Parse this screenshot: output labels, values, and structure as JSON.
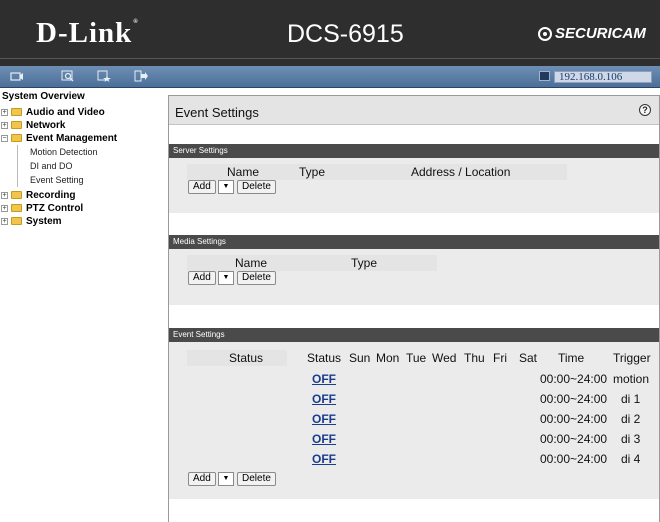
{
  "header": {
    "brand_logo": "D-Link",
    "model": "DCS-6915",
    "partner_logo": "SECURICAM",
    "ip_address": "192.168.0.106"
  },
  "toolbar": {
    "icons": [
      "camera-icon",
      "search-icon",
      "settings-star-icon",
      "logout-icon"
    ]
  },
  "sidebar": {
    "title": "System Overview",
    "items": [
      {
        "label": "Audio and Video",
        "expanded": false
      },
      {
        "label": "Network",
        "expanded": false
      },
      {
        "label": "Event Management",
        "expanded": true,
        "children": [
          "Motion Detection",
          "DI and DO",
          "Event Setting"
        ]
      },
      {
        "label": "Recording",
        "expanded": false
      },
      {
        "label": "PTZ Control",
        "expanded": false
      },
      {
        "label": "System",
        "expanded": false
      }
    ]
  },
  "panel": {
    "title": "Event Settings"
  },
  "server_settings": {
    "title": "Server Settings",
    "columns": [
      "Name",
      "Type",
      "Address / Location"
    ],
    "add_label": "Add",
    "delete_label": "Delete"
  },
  "media_settings": {
    "title": "Media Settings",
    "columns": [
      "Name",
      "Type"
    ],
    "add_label": "Add",
    "delete_label": "Delete"
  },
  "event_settings": {
    "title": "Event Settings",
    "columns": [
      "Status",
      "Status",
      "Sun",
      "Mon",
      "Tue",
      "Wed",
      "Thu",
      "Fri",
      "Sat",
      "Time",
      "Trigger"
    ],
    "rows": [
      {
        "status": "OFF",
        "time": "00:00~24:00",
        "trigger": "motion"
      },
      {
        "status": "OFF",
        "time": "00:00~24:00",
        "trigger": "di 1"
      },
      {
        "status": "OFF",
        "time": "00:00~24:00",
        "trigger": "di 2"
      },
      {
        "status": "OFF",
        "time": "00:00~24:00",
        "trigger": "di 3"
      },
      {
        "status": "OFF",
        "time": "00:00~24:00",
        "trigger": "di 4"
      }
    ],
    "add_label": "Add",
    "delete_label": "Delete"
  },
  "colors": {
    "header_bg": "#2e2e2e",
    "toolbar_bg": "#5a7ea8",
    "section_bar": "#4a4a4a",
    "link": "#1a3c8c"
  }
}
